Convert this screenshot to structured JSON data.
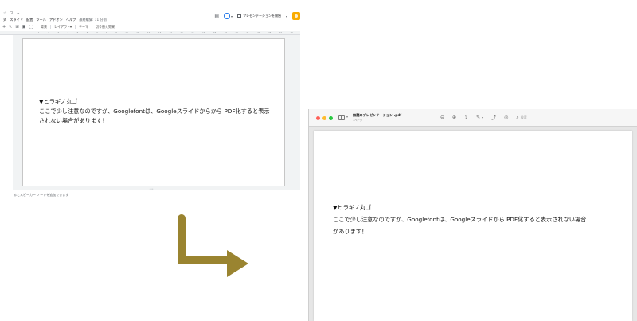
{
  "slides_window": {
    "toolbar_icons_text": "☆ ⊡ ☁",
    "menu": [
      "式",
      "スライド",
      "配置",
      "ツール",
      "アドオン",
      "ヘルプ"
    ],
    "last_edit": "最終編集: 11 分前",
    "present_label": "プレゼンテーションを開始",
    "toolbar_items": [
      "背景",
      "レイアウト▾",
      "テーマ",
      "切り替え効果"
    ],
    "ruler_numbers": [
      "1",
      "2",
      "3",
      "4",
      "5",
      "6",
      "7",
      "8",
      "9",
      "10",
      "11",
      "12",
      "13",
      "14",
      "15",
      "16",
      "17",
      "18",
      "19",
      "20",
      "21",
      "22",
      "23",
      "24",
      "25"
    ],
    "slide_text": {
      "line1": "▼ヒラギノ丸ゴ",
      "line2": "ここで少し注意なのですが、Googlefontは、Googleスライドからから PDF化すると表示",
      "line3": "されない場合があります！"
    },
    "notes_placeholder": "るとスピーカー ノートを追加できます"
  },
  "preview_window": {
    "title": "無題のプレゼンテーション .pdf",
    "subtitle": "1ページ",
    "search_placeholder": "検索",
    "page_text": {
      "line1": "▼ヒラギノ丸ゴ",
      "line2": "ここで少し注意なのですが、Googlefontは、Googleスライドから PDF化すると表示されない場合",
      "line3": "があります！"
    }
  },
  "colors": {
    "arrow": "#9a8430",
    "share_button": "#f9ab00",
    "accent_blue": "#1a73e8",
    "traffic_red": "#ff5f57",
    "traffic_yellow": "#febc2e",
    "traffic_green": "#28c840"
  }
}
